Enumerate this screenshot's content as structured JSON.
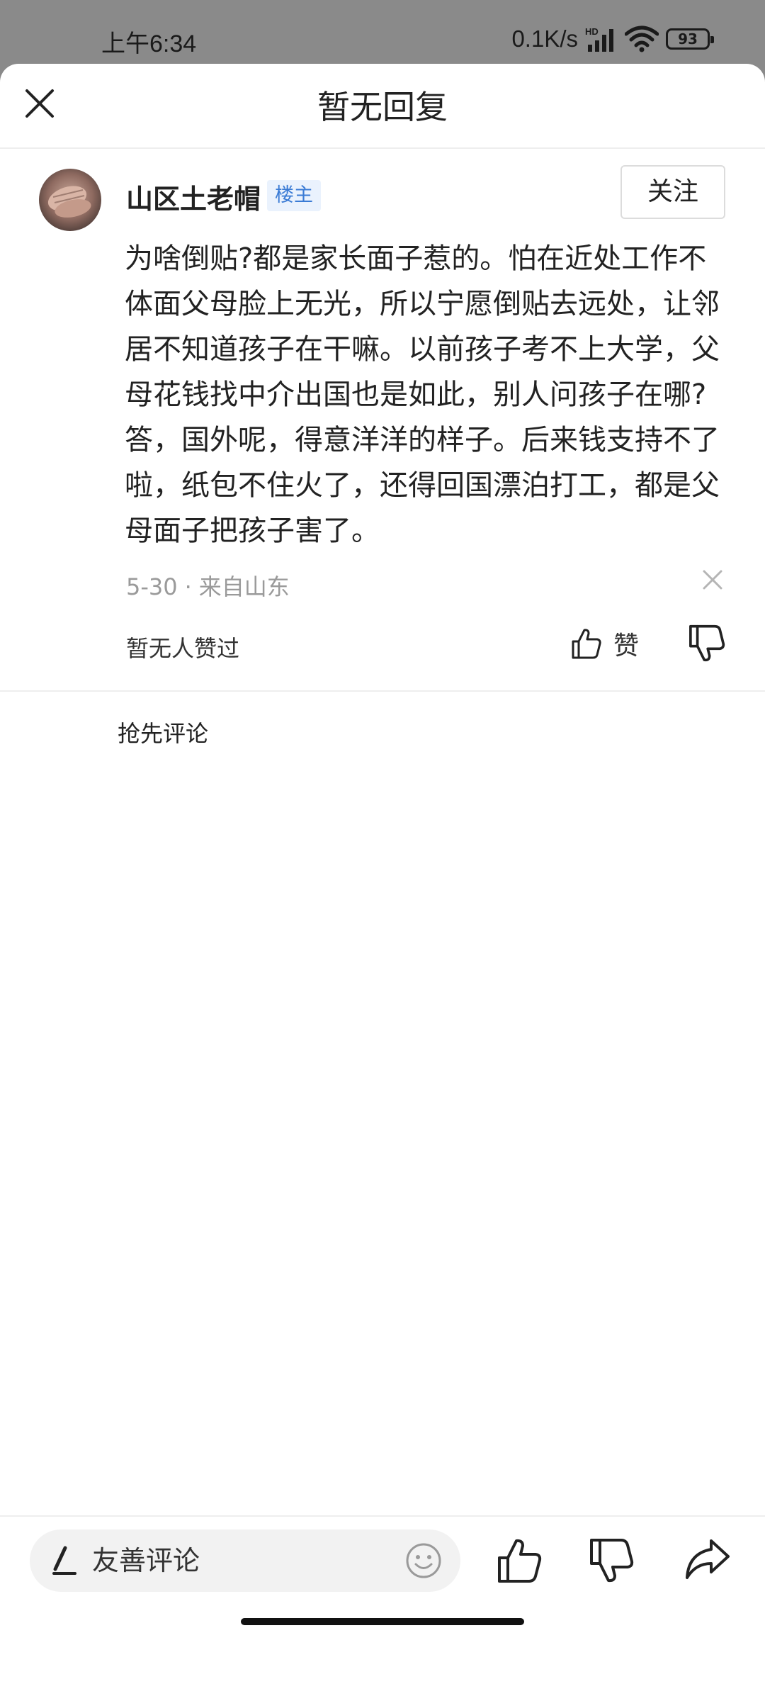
{
  "status_bar": {
    "time": "上午6:34",
    "net_speed": "0.1K/s",
    "battery": "93"
  },
  "header": {
    "title": "暂无回复"
  },
  "comment": {
    "username": "山区土老帽",
    "badge": "楼主",
    "follow_label": "关注",
    "text": "为啥倒贴?都是家长面子惹的。怕在近处工作不体面父母脸上无光，所以宁愿倒贴去远处，让邻居不知道孩子在干嘛。以前孩子考不上大学，父母花钱找中介出国也是如此，别人问孩子在哪?答，国外呢，得意洋洋的样子。后来钱支持不了啦，纸包不住火了，还得回国漂泊打工，都是父母面子把孩子害了。",
    "date": "5-30",
    "location": "来自山东",
    "likes_status": "暂无人赞过",
    "like_label": "赞"
  },
  "replies": {
    "empty_prompt": "抢先评论"
  },
  "bottom_bar": {
    "input_placeholder": "友善评论"
  },
  "colors": {
    "badge_text": "#3a7bd5",
    "badge_bg": "#eaf2fd",
    "meta_text": "#9a9a9a",
    "status_bar_bg": "#8a8a8a"
  },
  "icons": [
    "close-icon",
    "x-icon",
    "thumbs-up-icon",
    "thumbs-down-icon",
    "pen-icon",
    "emoji-icon",
    "share-icon",
    "wifi-icon",
    "signal-icon",
    "battery-icon"
  ]
}
